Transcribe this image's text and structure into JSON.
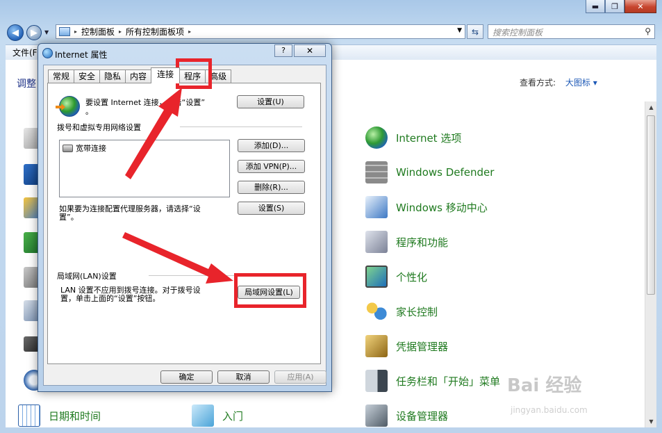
{
  "explorer": {
    "window_controls": {
      "minimize": "▬",
      "maximize": "❐",
      "close": "✕"
    },
    "back_arrow": "◀",
    "forward_arrow": "▶",
    "breadcrumbs": [
      "控制面板",
      "所有控制面板项"
    ],
    "breadcrumb_sep": "▸",
    "search_placeholder": "搜索控制面板",
    "menu_visible": "文件(F",
    "page_heading": "调整",
    "view_by_label": "查看方式:",
    "view_by_value": "大图标 ▾",
    "items_right": [
      {
        "label": "Internet 选项",
        "icon": "internet-options-icon",
        "color": "#2e7fd0"
      },
      {
        "label": "Windows Defender",
        "icon": "windows-defender-icon",
        "color": "#7a7a7a"
      },
      {
        "label": "Windows 移动中心",
        "icon": "mobility-center-icon",
        "color": "#3d78c4"
      },
      {
        "label": "程序和功能",
        "icon": "programs-features-icon",
        "color": "#9a9fb0"
      },
      {
        "label": "个性化",
        "icon": "personalization-icon",
        "color": "#2e9a52"
      },
      {
        "label": "家长控制",
        "icon": "parental-controls-icon",
        "color": "#3d8ad6"
      },
      {
        "label": "凭据管理器",
        "icon": "credential-manager-icon",
        "color": "#b58a2a"
      },
      {
        "label": "任务栏和「开始」菜单",
        "icon": "taskbar-start-menu-icon",
        "color": "#5a6570"
      },
      {
        "label": "设备管理器",
        "icon": "device-manager-icon",
        "color": "#6d7b88"
      }
    ],
    "items_bottom": [
      {
        "label": "日期和时间",
        "icon": "date-time-icon",
        "color": "#3f7fd0"
      },
      {
        "label": "入门",
        "icon": "getting-started-icon",
        "color": "#4aa3d8"
      }
    ]
  },
  "dialog": {
    "title": "Internet 属性",
    "help_label": "?",
    "close_label": "✕",
    "tabs": [
      "常规",
      "安全",
      "隐私",
      "内容",
      "连接",
      "程序",
      "高级"
    ],
    "setup_text_1": "要设置 Internet 连接，单击“设置”",
    "setup_text_2": "。",
    "setup_button": "设置(U)",
    "dialup_group": "拨号和虚拟专用网络设置",
    "connections": [
      "宽带连接"
    ],
    "add_button": "添加(D)...",
    "add_vpn_button": "添加 VPN(P)...",
    "remove_button": "删除(R)...",
    "proxy_text_1": "如果要为连接配置代理服务器，请选择“设",
    "proxy_text_2": "置”。",
    "settings_button": "设置(S)",
    "lan_group": "局域网(LAN)设置",
    "lan_text_1": "LAN 设置不应用到拨号连接。对于拨号设",
    "lan_text_2": "置，单击上面的“设置”按钮。",
    "lan_button": "局域网设置(L)",
    "ok_button": "确定",
    "cancel_button": "取消",
    "apply_button": "应用(A)"
  },
  "watermark": {
    "brand": "Bai 经验",
    "url": "jingyan.baidu.com"
  },
  "colors": {
    "annotation": "#e8242b",
    "link_green": "#1f7a1f",
    "link_blue": "#1c58b6"
  }
}
